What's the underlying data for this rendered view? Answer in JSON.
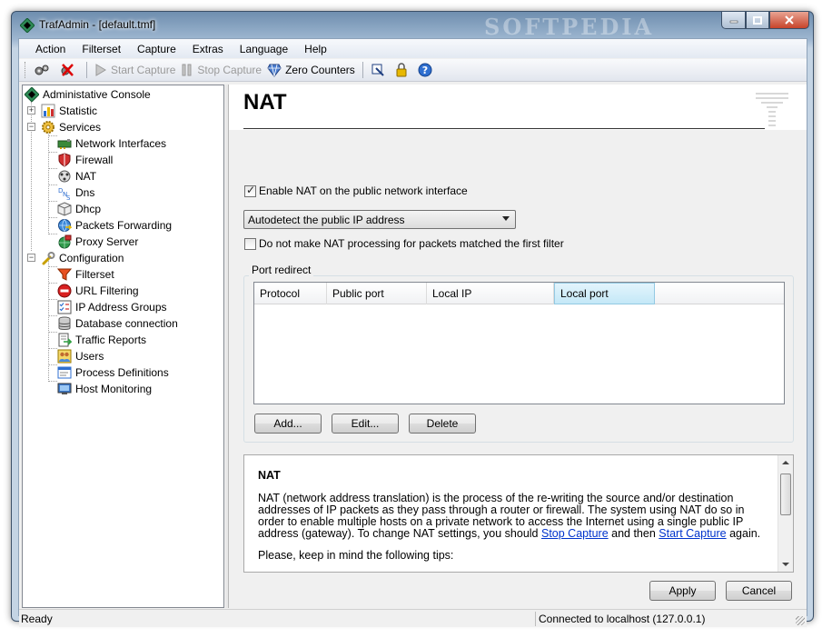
{
  "window": {
    "title": "TrafAdmin - [default.tmf]",
    "watermark": "SOFTPEDIA"
  },
  "menu": {
    "items": [
      "Action",
      "Filterset",
      "Capture",
      "Extras",
      "Language",
      "Help"
    ]
  },
  "toolbar": {
    "start_capture": "Start Capture",
    "stop_capture": "Stop Capture",
    "zero_counters": "Zero Counters"
  },
  "tree": {
    "root": "Administative Console",
    "statistic": "Statistic",
    "services": "Services",
    "services_children": [
      "Network Interfaces",
      "Firewall",
      "NAT",
      "Dns",
      "Dhcp",
      "Packets Forwarding",
      "Proxy Server"
    ],
    "configuration": "Configuration",
    "configuration_children": [
      "Filterset",
      "URL Filtering",
      "IP Address Groups",
      "Database connection",
      "Traffic Reports",
      "Users",
      "Process Definitions",
      "Host Monitoring"
    ]
  },
  "nat": {
    "title": "NAT",
    "enable_label": "Enable NAT on the public network interface",
    "enable_checked": true,
    "ip_select": "Autodetect the public IP address",
    "no_nat_label": "Do not make NAT processing for packets matched the first filter",
    "no_nat_checked": false,
    "port_redirect_label": "Port redirect",
    "columns": [
      "Protocol",
      "Public port",
      "Local IP",
      "Local port"
    ],
    "add_button": "Add...",
    "edit_button": "Edit...",
    "delete_button": "Delete"
  },
  "help": {
    "title": "NAT",
    "text_1": "NAT (network address translation) is the process of the re-writing the source and/or destination addresses of IP packets as they pass through a router or firewall. The system using NAT do so in order to enable multiple hosts on a private network to access the Internet using a single public IP address (gateway). To change NAT settings, you should ",
    "link_stop": "Stop Capture",
    "text_2": " and then ",
    "link_start": "Start Capture",
    "text_3": " again.",
    "tips": "Please, keep in mind the following tips:"
  },
  "footer": {
    "apply": "Apply",
    "cancel": "Cancel"
  },
  "status": {
    "left": "Ready",
    "right": "Connected to localhost (127.0.0.1)"
  }
}
